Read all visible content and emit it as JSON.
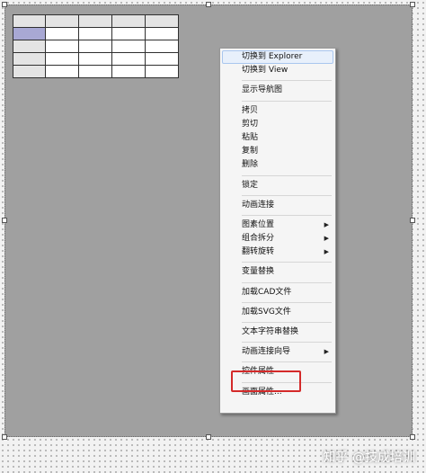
{
  "grid": {
    "rows": 5,
    "cols": 5
  },
  "context_menu": {
    "sections": [
      [
        {
          "label": "切换到 Explorer",
          "hover": true
        },
        {
          "label": "切换到 View"
        }
      ],
      [
        {
          "label": "显示导航图"
        }
      ],
      [
        {
          "label": "拷贝"
        },
        {
          "label": "剪切"
        },
        {
          "label": "粘贴"
        },
        {
          "label": "复制"
        },
        {
          "label": "删除"
        }
      ],
      [
        {
          "label": "锁定"
        }
      ],
      [
        {
          "label": "动画连接"
        }
      ],
      [
        {
          "label": "图素位置",
          "submenu": true
        },
        {
          "label": "组合拆分",
          "submenu": true
        },
        {
          "label": "翻转旋转",
          "submenu": true
        }
      ],
      [
        {
          "label": "变量替换"
        }
      ],
      [
        {
          "label": "加载CAD文件"
        }
      ],
      [
        {
          "label": "加载SVG文件"
        }
      ],
      [
        {
          "label": "文本字符串替换"
        }
      ],
      [
        {
          "label": "动画连接向导",
          "submenu": true
        }
      ],
      [
        {
          "label": "控件属性",
          "annotated": true
        }
      ],
      [
        {
          "label": "画面属性..."
        }
      ]
    ],
    "submenu_arrow": "▶"
  },
  "watermark": "知乎 @技成培训",
  "colors": {
    "canvas": "#a0a0a0",
    "annotation": "#d42a2a",
    "selected_cell": "#a8a8d4"
  }
}
